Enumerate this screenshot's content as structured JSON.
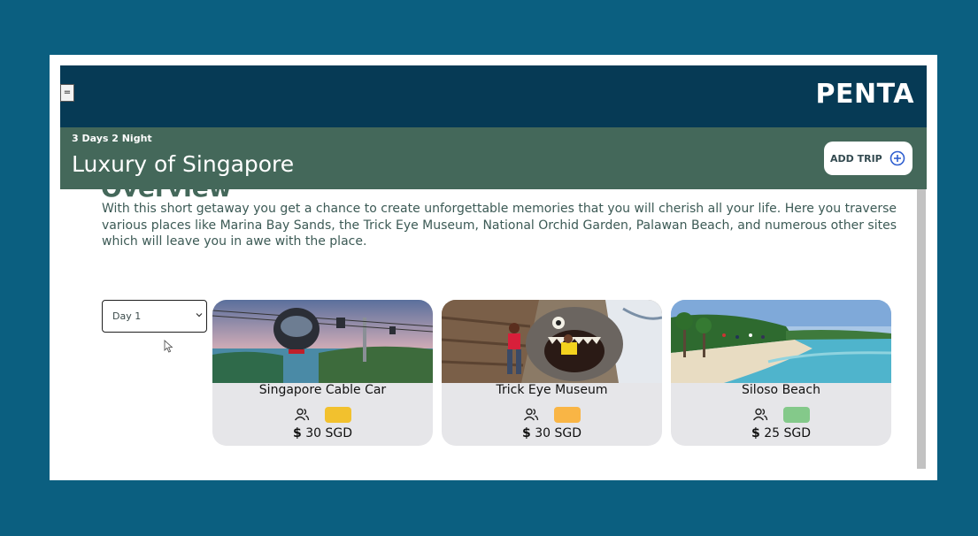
{
  "app": {
    "brand": "PENTA",
    "menu_icon": "="
  },
  "trip": {
    "duration": "3 Days 2 Night",
    "title": "Luxury of Singapore",
    "add_button_label": "ADD TRIP",
    "add_button_icon": "plus-circle-icon",
    "section_heading_partial": "Overview",
    "description": "With this short getaway you get a chance to create unforgettable memories that you will cherish all your life. Here you traverse various places like Marina Bay Sands, the Trick Eye Museum, National Orchid Garden, Palawan Beach, and numerous other sites which will leave you in awe with the place."
  },
  "day_select": {
    "value": "Day 1"
  },
  "cards": [
    {
      "name": "Singapore Cable Car",
      "currency_symbol": "$",
      "price": "30 SGD",
      "tag_color": "#f2c12e",
      "group_icon": "people-icon"
    },
    {
      "name": "Trick Eye Museum",
      "currency_symbol": "$",
      "price": "30 SGD",
      "tag_color": "#f9b545",
      "group_icon": "people-icon"
    },
    {
      "name": "Siloso Beach",
      "currency_symbol": "$",
      "price": "25 SGD",
      "tag_color": "#84c98a",
      "group_icon": "people-icon"
    }
  ],
  "colors": {
    "background": "#0b5f80",
    "header": "#063a55",
    "trip_band": "#44685a",
    "card_bg": "#e6e6e9"
  }
}
